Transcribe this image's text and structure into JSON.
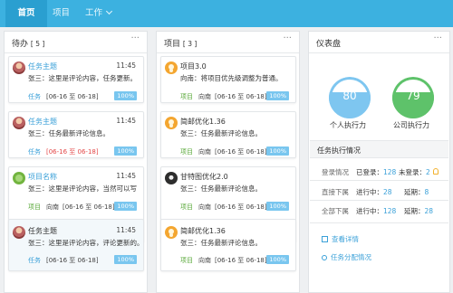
{
  "nav": {
    "home": "首页",
    "project": "项目",
    "work": "工作"
  },
  "todo": {
    "title": "待办",
    "count": "[ 5 ]",
    "more": "···",
    "cards": [
      {
        "title": "任务主题",
        "time": "11:45",
        "text": "张三：这里是评论内容，任务更新。",
        "tag": "任务",
        "date": "[06-16 至 06-18]",
        "pct": "100%"
      },
      {
        "title": "任务主题",
        "time": "11:45",
        "text": "张三：任务最新评论信息。",
        "tag": "任务",
        "date": "[06-16 至 06-18]",
        "pct": "100%"
      },
      {
        "title": "项目名称",
        "time": "11:45",
        "text": "张三：这里是评论内容，当然可以写",
        "tag": "项目",
        "who": "向南",
        "date": "[06-16 至 06-18]",
        "pct": "100%"
      },
      {
        "title": "任务主题",
        "time": "11:45",
        "text": "张三：这里是评论内容，评论更新的。",
        "tag": "任务",
        "date": "[06-16 至 06-18]",
        "pct": "100%"
      }
    ]
  },
  "projects": {
    "title": "项目",
    "count": "[ 3 ]",
    "more": "···",
    "cards": [
      {
        "title": "项目3.0",
        "text": "向南：将项目优先级调整为普通。",
        "tag": "项目",
        "who": "向南",
        "date": "[06-16 至 06-18]",
        "pct": "100%"
      },
      {
        "title": "简邮优化1.36",
        "text": "张三：任务最新评论信息。",
        "tag": "项目",
        "who": "向南",
        "date": "[06-16 至 06-18]",
        "pct": "100%"
      },
      {
        "title": "甘特图优化2.0",
        "text": "张三：任务最新评论信息。",
        "tag": "项目",
        "who": "向南",
        "date": "[06-16 至 06-18]",
        "pct": "100%"
      },
      {
        "title": "简邮优化1.36",
        "text": "张三：任务最新评论信息。",
        "tag": "项目",
        "who": "向南",
        "date": "[06-16 至 06-18]",
        "pct": "100%"
      }
    ]
  },
  "dashboard": {
    "title": "仪表盘",
    "more": "···",
    "gauge_personal": {
      "value": "80",
      "label": "个人执行力",
      "fill": 0.62,
      "color": "#7ec6f0"
    },
    "gauge_company": {
      "value": "79",
      "label": "公司执行力",
      "fill": 0.62,
      "color": "#5ec26a"
    },
    "section_title": "任务执行情况",
    "rows": [
      {
        "label": "登录情况",
        "a_label": "已登录：",
        "a_val": "128",
        "b_label": "未登录：",
        "b_val": "2"
      },
      {
        "label": "直接下属",
        "a_label": "进行中：",
        "a_val": "28",
        "b_label": "延期：",
        "b_val": "8"
      },
      {
        "label": "全部下属",
        "a_label": "进行中：",
        "a_val": "128",
        "b_label": "延期：",
        "b_val": "28"
      }
    ],
    "link_detail": "查看详情",
    "link_assign": "任务分配情况"
  }
}
